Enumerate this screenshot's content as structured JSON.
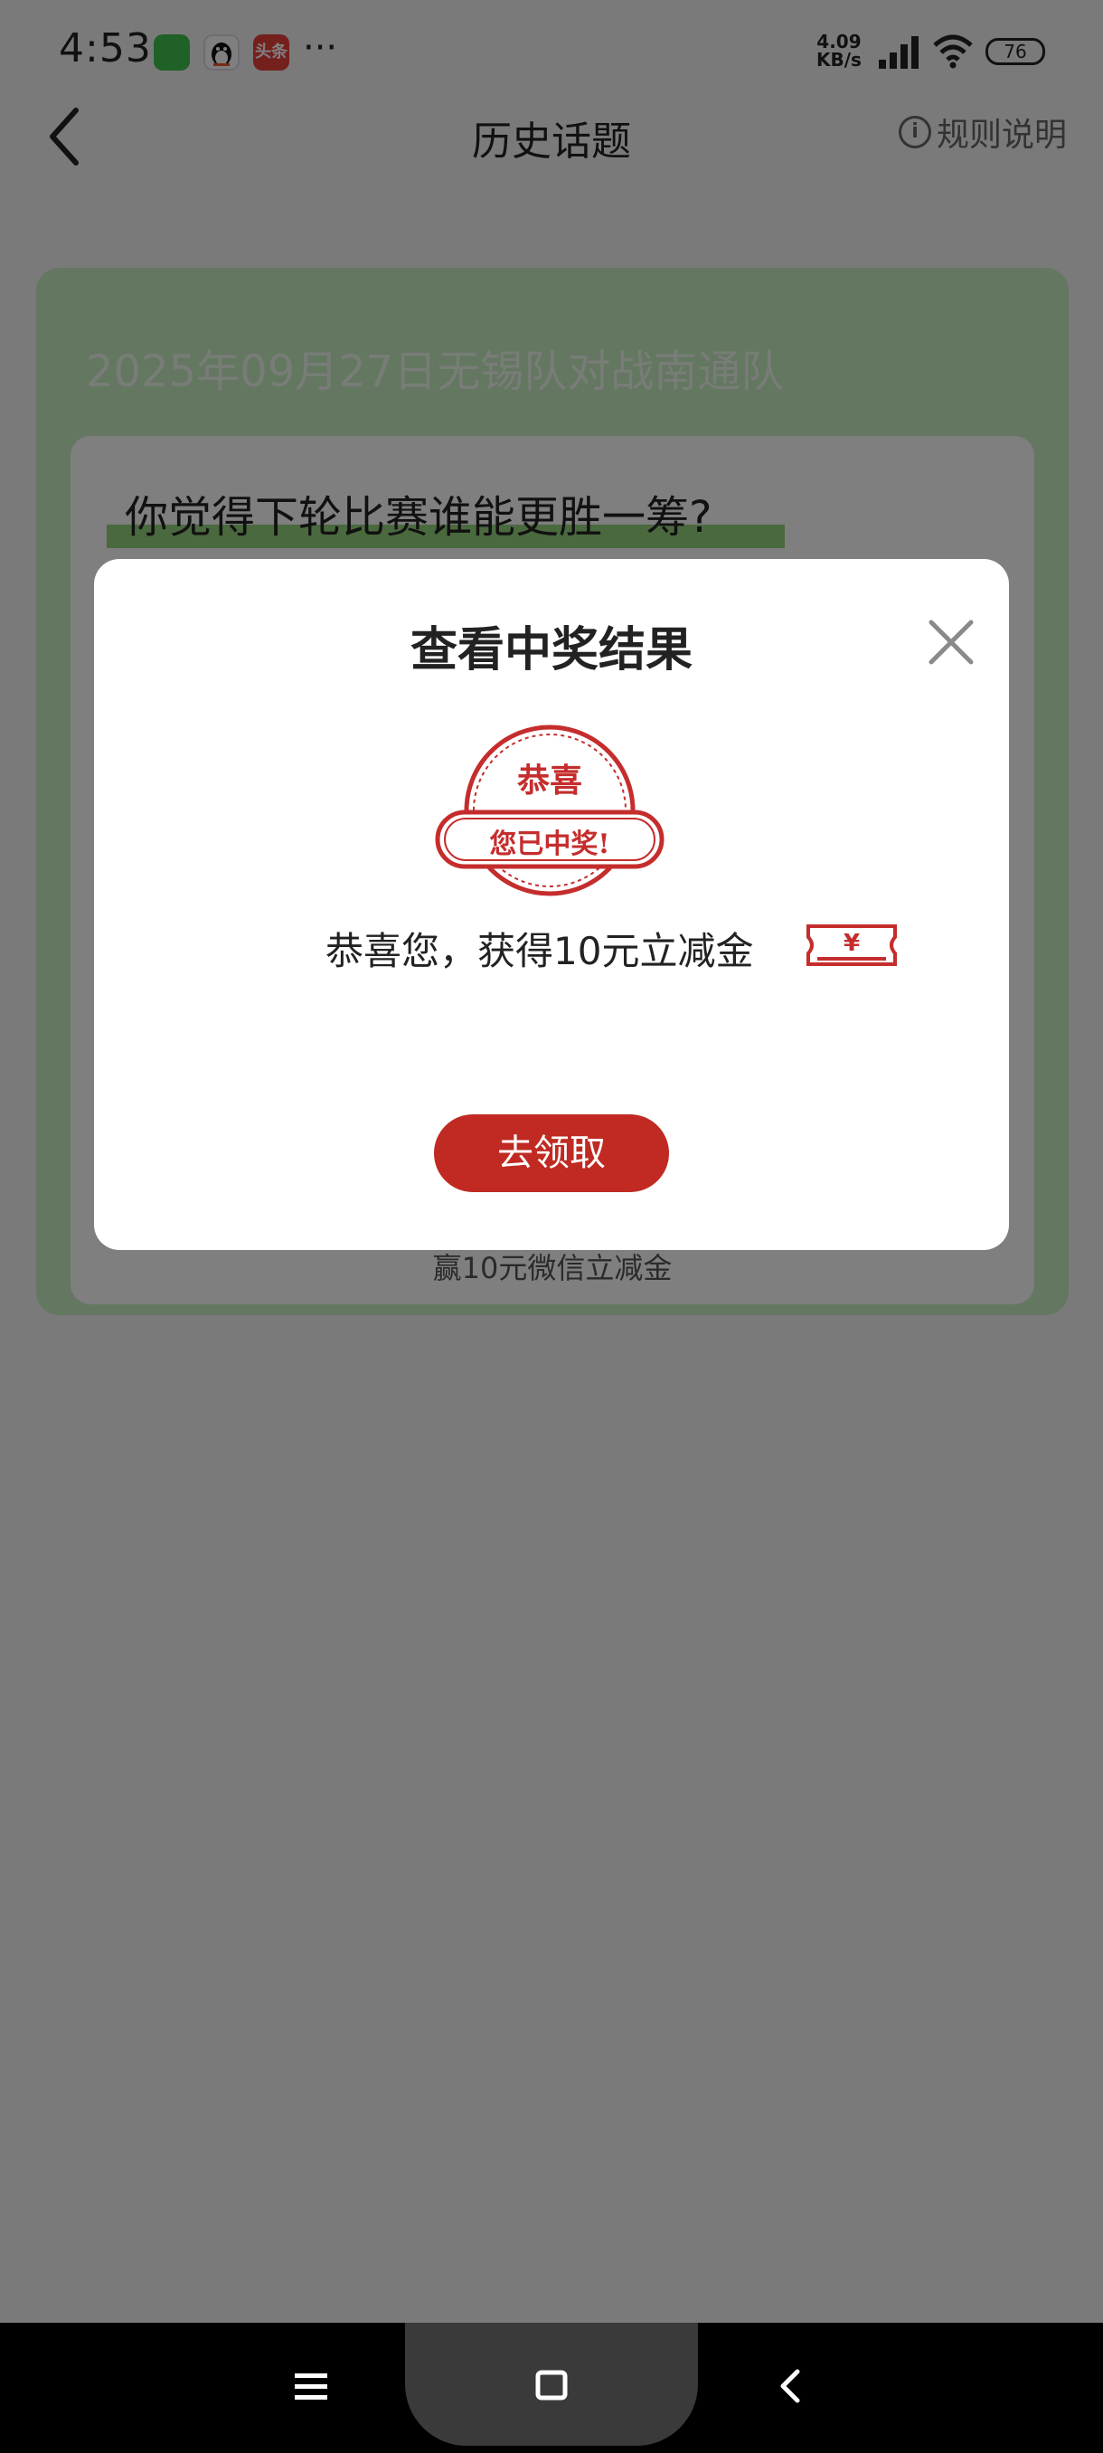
{
  "status_bar": {
    "time": "4:53",
    "toutiao_label": "头条",
    "more": "···",
    "net_speed_value": "4.09",
    "net_speed_unit": "KB/s",
    "battery": "76"
  },
  "header": {
    "title": "历史话题",
    "rules_label": "规则说明"
  },
  "topic": {
    "date_match": "2025年09月27日无锡队对战南通队",
    "question": "你觉得下轮比赛谁能更胜一筹?",
    "prize_line": "赢10元微信立减金"
  },
  "modal": {
    "title": "查看中奖结果",
    "stamp_top": "恭喜",
    "stamp_bottom": "您已中奖!",
    "congrats": "恭喜您，获得10元立减金",
    "coupon_symbol": "¥",
    "claim_button": "去领取",
    "accent_color": "#c02a22"
  },
  "colors": {
    "card_green": "#c8eec3",
    "highlight_green": "#94d27f"
  }
}
